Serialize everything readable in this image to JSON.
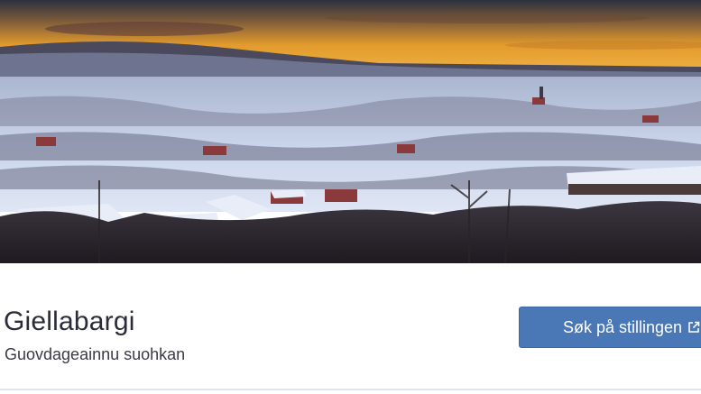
{
  "hero": {
    "image_icon": "arctic-village-sunset-photo"
  },
  "job": {
    "title": "Giellabargi",
    "employer": "Guovdageainnu suohkan"
  },
  "actions": {
    "apply_label": "Søk på stillingen",
    "apply_icon": "external-link-icon",
    "apply_color": "#4a77b6"
  }
}
